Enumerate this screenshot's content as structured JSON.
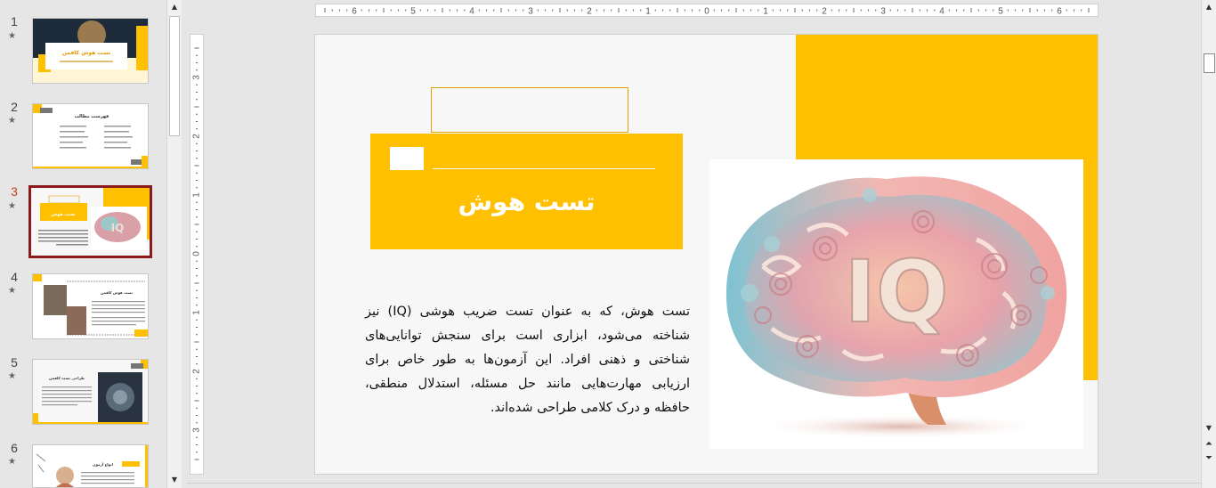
{
  "thumbnails": [
    {
      "number": "1",
      "title": "تست هوش کافمن"
    },
    {
      "number": "2",
      "title": "فهرست مطالب"
    },
    {
      "number": "3",
      "title": "تست هوش"
    },
    {
      "number": "4",
      "title": "تست هوش کافمن"
    },
    {
      "number": "5",
      "title": "طراحی تست کافمن"
    },
    {
      "number": "6",
      "title": "انواع آزمون"
    }
  ],
  "active_slide": "3",
  "star_glyph": "★",
  "ruler": {
    "h_labels": [
      "6",
      "5",
      "4",
      "3",
      "2",
      "1",
      "0",
      "1",
      "2",
      "3",
      "4",
      "5",
      "6"
    ],
    "v_labels": [
      "3",
      "2",
      "1",
      "0",
      "1",
      "2",
      "3"
    ]
  },
  "slide": {
    "title": "تست هوش",
    "body": "تست هوش، که به عنوان تست ضریب هوشی (IQ) نیز شناخته می‌شود، ابزاری است برای سنجش توانایی‌های شناختی و ذهنی افراد. این آزمون‌ها به طور خاص برای ارزیابی مهارت‌هایی مانند حل مسئله، استدلال منطقی، حافظه و درک کلامی طراحی شده‌اند.",
    "image_text": "IQ"
  },
  "colors": {
    "accent": "#fec000",
    "active_border": "#8b1a1a",
    "active_number": "#c43e1c"
  },
  "icons": {
    "scroll_up": "scroll-up-icon",
    "scroll_down": "scroll-down-icon",
    "prev_slide": "previous-slide-icon",
    "next_slide": "next-slide-icon"
  }
}
